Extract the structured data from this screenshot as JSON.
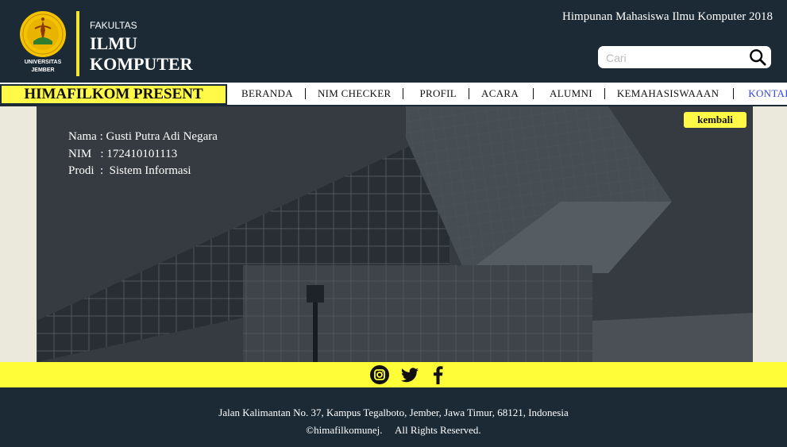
{
  "header": {
    "logo_caption_1": "UNIVERSITAS",
    "logo_caption_2": "JEMBER",
    "logo_ring_text": "UNIVERSITAS JEMBER",
    "faculty_small": "FAKULTAS",
    "faculty_line_1": "ILMU",
    "faculty_line_2": "KOMPUTER",
    "org_title": "Himpunan Mahasiswa Ilmu Komputer 2018"
  },
  "search": {
    "placeholder": "Cari",
    "value": "",
    "icon": "search-icon"
  },
  "navbar": {
    "brand": "HIMAFILKOM PRESENT",
    "items": [
      {
        "label": "BERANDA",
        "active": false
      },
      {
        "label": "NIM CHECKER",
        "active": false
      },
      {
        "label": "PROFIL",
        "active": false
      },
      {
        "label": "ACARA",
        "active": false
      },
      {
        "label": "ALUMNI",
        "active": false
      },
      {
        "label": "KEMAHASISWAAAN",
        "active": false
      },
      {
        "label": "KONTAK",
        "active": true
      }
    ]
  },
  "student": {
    "nama_row": "Nama : Gusti Putra Adi Negara",
    "nim_row": "NIM   : 172410101113",
    "prodi_row": "Prodi  :  Sistem Informasi"
  },
  "back_button": "kembali",
  "social": [
    "instagram-icon",
    "twitter-icon",
    "facebook-icon"
  ],
  "footer": {
    "address": "Jalan Kalimantan No. 37, Kampus Tegalboto, Jember, Jawa Timur, 68121, Indonesia",
    "copyright": "©himafilkomunej.     All Rights Reserved."
  },
  "colors": {
    "dark_navy": "#1b2a35",
    "accent_yellow": "#fff947",
    "active_link": "#3547e8",
    "page_background": "#ebe8dc"
  }
}
